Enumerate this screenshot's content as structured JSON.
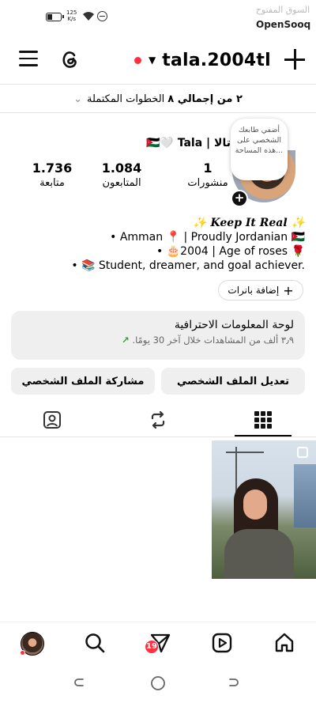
{
  "status_bar": {
    "net_speed_value": "125",
    "net_speed_unit": "K/s",
    "watermark_ar": "السوق المفتوح",
    "watermark_en": "OpenSooq"
  },
  "top_bar": {
    "username": "tala.2004tl",
    "menu_icon": "hamburger-icon",
    "threads_icon": "threads-icon",
    "create_icon": "plus-icon"
  },
  "steps_banner": {
    "count_text": "٢ من إجمالي ٨",
    "label": "الخطوات المكتملة"
  },
  "profile": {
    "note_text": "أضفي طابعك الشخصي على هذه المساحة...",
    "display_name": "تالا | 🇯🇴🤍 Tala",
    "stats": [
      {
        "value": "1",
        "label": "منشورات"
      },
      {
        "value": "1.084",
        "label": "المتابعون"
      },
      {
        "value": "1.736",
        "label": "متابعة"
      }
    ],
    "bio_title": "✨ Keep It Real ✨",
    "bio_lines": [
      "• Amman 📍 | Proudly Jordanian 🇯🇴",
      "• 🎂2004 | Age of roses 🌹",
      "• 📚 Student, dreamer, and goal achiever."
    ],
    "add_banners_label": "إضافة بانرات"
  },
  "dashboard": {
    "title": "لوحة المعلومات الاحترافية",
    "subtitle": "٣٫٩ ألف من المشاهدات خلال آخر 30 يومًا."
  },
  "actions": {
    "edit_profile": "تعديل الملف الشخصي",
    "share_profile": "مشاركة الملف الشخصي"
  },
  "tabs": [
    "grid-icon",
    "reels-icon",
    "tagged-icon"
  ],
  "bottom_nav": {
    "items": [
      "home-icon",
      "reels-icon",
      "direct-icon",
      "search-icon",
      "profile-avatar"
    ],
    "direct_badge": "19"
  },
  "colors": {
    "accent_red": "#ff3040",
    "growth_green": "#2e9e3b",
    "panel_gray": "#efefef"
  }
}
